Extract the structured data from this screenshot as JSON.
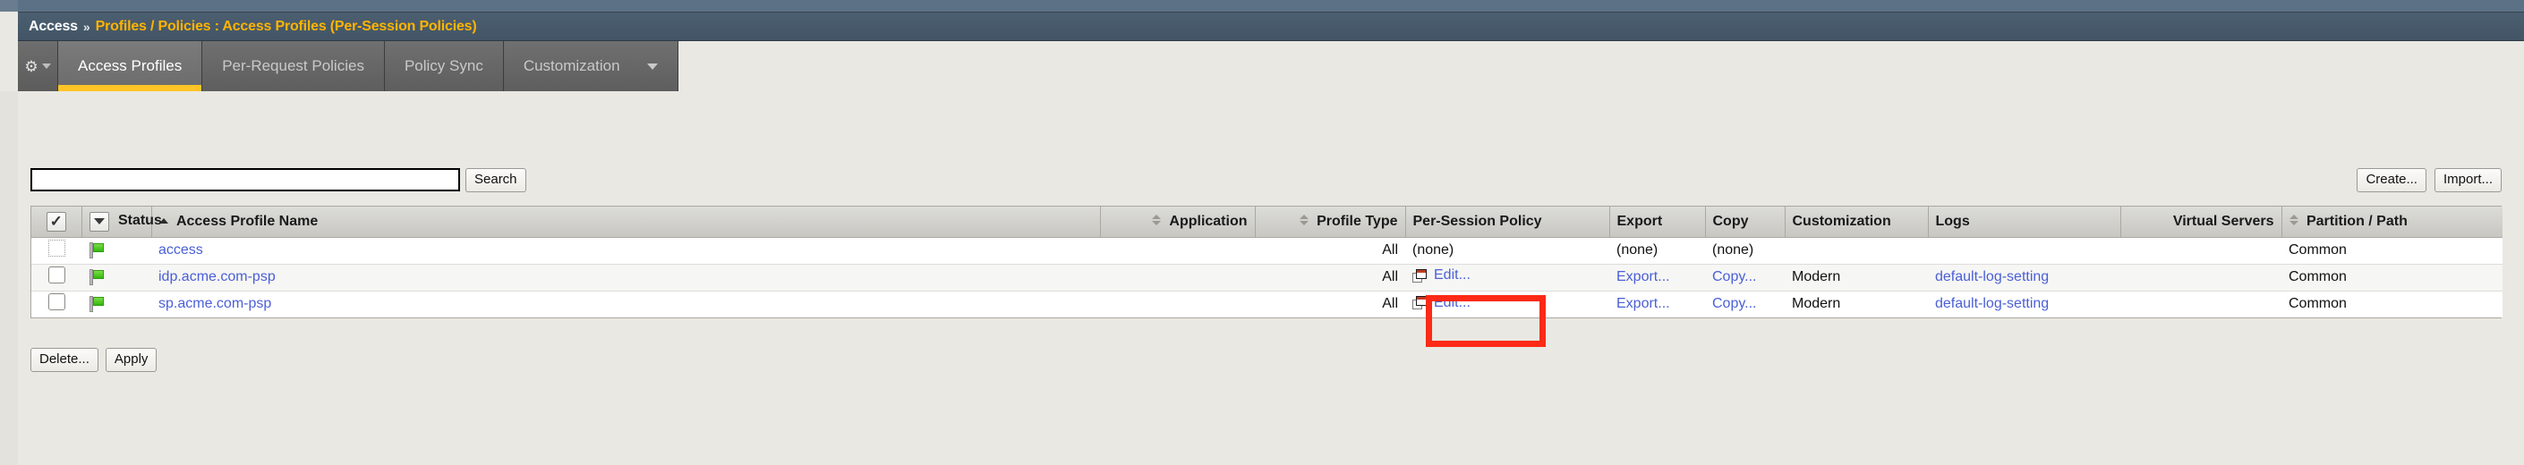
{
  "breadcrumb": {
    "root": "Access",
    "separator": "»",
    "path": "Profiles / Policies : Access Profiles (Per-Session Policies)"
  },
  "tabs": {
    "gear_icon": "gear-icon",
    "items": [
      {
        "label": "Access Profiles",
        "active": true,
        "has_caret": false
      },
      {
        "label": "Per-Request Policies",
        "active": false,
        "has_caret": false
      },
      {
        "label": "Policy Sync",
        "active": false,
        "has_caret": false
      },
      {
        "label": "Customization",
        "active": false,
        "has_caret": true
      }
    ]
  },
  "search": {
    "value": "",
    "placeholder": "",
    "button_label": "Search"
  },
  "actions": {
    "create_label": "Create...",
    "import_label": "Import...",
    "delete_label": "Delete...",
    "apply_label": "Apply"
  },
  "table": {
    "headers": [
      {
        "label": "",
        "sort": "none",
        "kind": "checkbox",
        "align": "center"
      },
      {
        "label": "Status",
        "sort": "none",
        "kind": "dropdown",
        "align": "left"
      },
      {
        "label": "Access Profile Name",
        "sort": "asc",
        "kind": "text",
        "align": "left"
      },
      {
        "label": "Application",
        "sort": "both",
        "kind": "text",
        "align": "right"
      },
      {
        "label": "Profile Type",
        "sort": "both",
        "kind": "text",
        "align": "right"
      },
      {
        "label": "Per-Session Policy",
        "sort": "none",
        "kind": "text",
        "align": "left"
      },
      {
        "label": "Export",
        "sort": "none",
        "kind": "text",
        "align": "left"
      },
      {
        "label": "Copy",
        "sort": "none",
        "kind": "text",
        "align": "left"
      },
      {
        "label": "Customization",
        "sort": "none",
        "kind": "text",
        "align": "left"
      },
      {
        "label": "Logs",
        "sort": "none",
        "kind": "text",
        "align": "left"
      },
      {
        "label": "Virtual Servers",
        "sort": "none",
        "kind": "text",
        "align": "right"
      },
      {
        "label": "Partition / Path",
        "sort": "both",
        "kind": "text",
        "align": "left"
      }
    ],
    "header_select_all_icon": "check-icon",
    "header_status_filter_icon": "chevron-down-icon",
    "rows": [
      {
        "checkbox_state": "disabled",
        "status_icon": "green-flag-icon",
        "name": "access",
        "application": "",
        "profile_type": "All",
        "per_session_policy": "(none)",
        "per_session_policy_is_link": false,
        "export": "(none)",
        "export_is_link": false,
        "copy": "(none)",
        "copy_is_link": false,
        "customization": "",
        "logs": "",
        "virtual_servers": "",
        "partition": "Common",
        "highlighted": false
      },
      {
        "checkbox_state": "unchecked",
        "status_icon": "green-flag-icon",
        "name": "idp.acme.com-psp",
        "application": "",
        "profile_type": "All",
        "per_session_policy": "Edit...",
        "per_session_policy_is_link": true,
        "export": "Export...",
        "export_is_link": true,
        "copy": "Copy...",
        "copy_is_link": true,
        "customization": "Modern",
        "logs": "default-log-setting",
        "virtual_servers": "",
        "partition": "Common",
        "highlighted": true
      },
      {
        "checkbox_state": "unchecked",
        "status_icon": "green-flag-icon",
        "name": "sp.acme.com-psp",
        "application": "",
        "profile_type": "All",
        "per_session_policy": "Edit...",
        "per_session_policy_is_link": true,
        "export": "Export...",
        "export_is_link": true,
        "copy": "Copy...",
        "copy_is_link": true,
        "customization": "Modern",
        "logs": "default-log-setting",
        "virtual_servers": "",
        "partition": "Common",
        "highlighted": false
      }
    ]
  },
  "colors": {
    "breadcrumb_bg": "#475a6b",
    "breadcrumb_path": "#ffb400",
    "tab_active_underline": "#ffc425",
    "link": "#4a5fd6",
    "status_flag": "#34b80d",
    "highlight_box": "#fc2a16",
    "page_bg": "#e9e8e2"
  }
}
